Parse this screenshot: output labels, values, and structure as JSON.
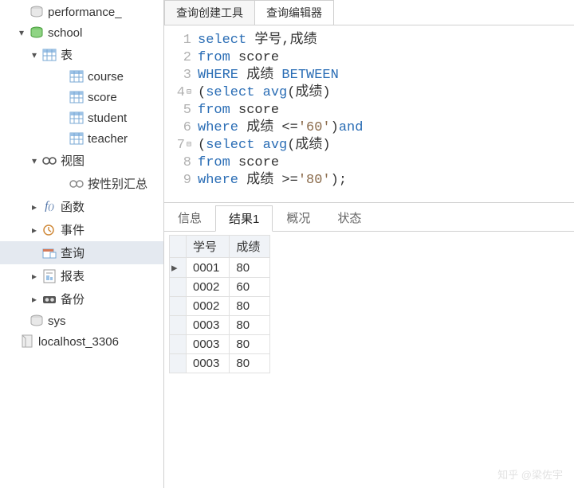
{
  "sidebar": {
    "items": [
      {
        "label": "performance_",
        "icon": "db",
        "indent": 1,
        "expand": ""
      },
      {
        "label": "school",
        "icon": "db-green",
        "indent": 1,
        "expand": "▾"
      },
      {
        "label": "表",
        "icon": "table-group",
        "indent": 2,
        "expand": "▾"
      },
      {
        "label": "course",
        "icon": "table",
        "indent": 3,
        "expand": ""
      },
      {
        "label": "score",
        "icon": "table",
        "indent": 3,
        "expand": ""
      },
      {
        "label": "student",
        "icon": "table",
        "indent": 3,
        "expand": ""
      },
      {
        "label": "teacher",
        "icon": "table",
        "indent": 3,
        "expand": ""
      },
      {
        "label": "视图",
        "icon": "view",
        "indent": 2,
        "expand": "▾"
      },
      {
        "label": "按性别汇总",
        "icon": "view-item",
        "indent": 3,
        "expand": ""
      },
      {
        "label": "函数",
        "icon": "fx",
        "indent": 2,
        "expand": "▸"
      },
      {
        "label": "事件",
        "icon": "event",
        "indent": 2,
        "expand": "▸"
      },
      {
        "label": "查询",
        "icon": "query",
        "indent": 2,
        "expand": "",
        "selected": true
      },
      {
        "label": "报表",
        "icon": "report",
        "indent": 2,
        "expand": "▸"
      },
      {
        "label": "备份",
        "icon": "backup",
        "indent": 2,
        "expand": "▸"
      },
      {
        "label": "sys",
        "icon": "db",
        "indent": 1,
        "expand": ""
      },
      {
        "label": "localhost_3306",
        "icon": "conn",
        "indent": 0,
        "expand": ""
      }
    ]
  },
  "tabs_top": [
    {
      "label": "查询创建工具",
      "active": false
    },
    {
      "label": "查询编辑器",
      "active": true
    }
  ],
  "editor": {
    "lines": [
      {
        "n": 1,
        "tokens": [
          [
            "kw",
            "select"
          ],
          [
            "txt",
            " 学号,成绩"
          ]
        ]
      },
      {
        "n": 2,
        "tokens": [
          [
            "kw",
            "from"
          ],
          [
            "txt",
            " score"
          ]
        ]
      },
      {
        "n": 3,
        "tokens": [
          [
            "kw",
            "WHERE"
          ],
          [
            "txt",
            " 成绩 "
          ],
          [
            "kw",
            "BETWEEN"
          ]
        ]
      },
      {
        "n": 4,
        "fold": true,
        "tokens": [
          [
            "txt",
            "("
          ],
          [
            "kw",
            "select"
          ],
          [
            "txt",
            " "
          ],
          [
            "kw",
            "avg"
          ],
          [
            "txt",
            "(成绩)"
          ]
        ]
      },
      {
        "n": 5,
        "tokens": [
          [
            "kw",
            "from"
          ],
          [
            "txt",
            " score"
          ]
        ]
      },
      {
        "n": 6,
        "tokens": [
          [
            "kw",
            "where"
          ],
          [
            "txt",
            " 成绩 <="
          ],
          [
            "str",
            "'60'"
          ],
          [
            "txt",
            ")"
          ],
          [
            "kw",
            "and"
          ]
        ]
      },
      {
        "n": 7,
        "fold": true,
        "tokens": [
          [
            "txt",
            "("
          ],
          [
            "kw",
            "select"
          ],
          [
            "txt",
            " "
          ],
          [
            "kw",
            "avg"
          ],
          [
            "txt",
            "(成绩)"
          ]
        ]
      },
      {
        "n": 8,
        "tokens": [
          [
            "kw",
            "from"
          ],
          [
            "txt",
            " score"
          ]
        ]
      },
      {
        "n": 9,
        "tokens": [
          [
            "kw",
            "where"
          ],
          [
            "txt",
            " 成绩 >="
          ],
          [
            "str",
            "'80'"
          ],
          [
            "txt",
            ");"
          ]
        ]
      }
    ]
  },
  "tabs_bottom": [
    {
      "label": "信息",
      "active": false
    },
    {
      "label": "结果1",
      "active": true
    },
    {
      "label": "概况",
      "active": false
    },
    {
      "label": "状态",
      "active": false
    }
  ],
  "result": {
    "columns": [
      "学号",
      "成绩"
    ],
    "rows": [
      [
        "0001",
        "80"
      ],
      [
        "0002",
        "60"
      ],
      [
        "0002",
        "80"
      ],
      [
        "0003",
        "80"
      ],
      [
        "0003",
        "80"
      ],
      [
        "0003",
        "80"
      ]
    ],
    "active_row": 0
  },
  "watermark": "知乎 @梁佐宇"
}
